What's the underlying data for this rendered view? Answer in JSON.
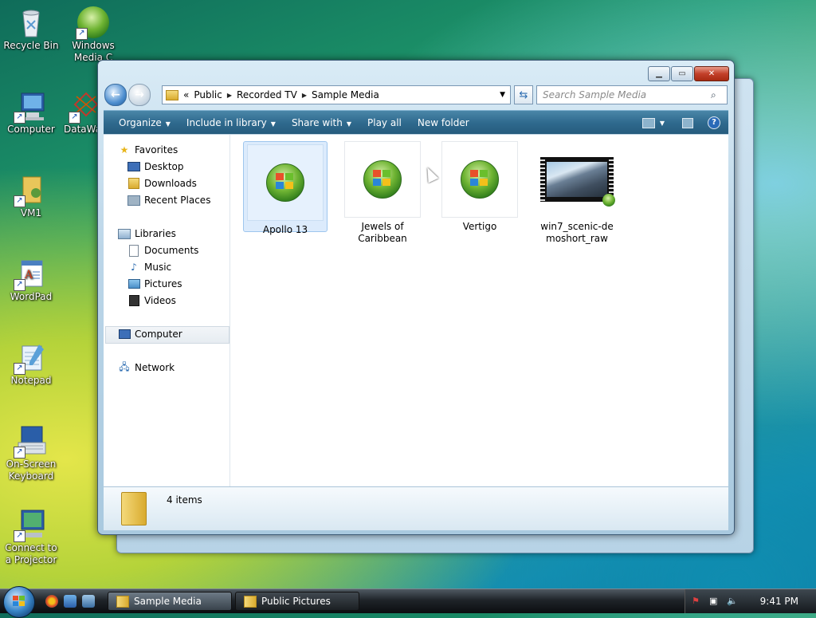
{
  "desktop": {
    "icons": [
      {
        "label": "Recycle Bin",
        "icon": "recycle-bin-icon"
      },
      {
        "label": "Windows Media C",
        "icon": "windows-media-center-icon"
      },
      {
        "label": "Computer",
        "icon": "computer-icon"
      },
      {
        "label": "DataWa",
        "icon": "datawarehouse-icon"
      },
      {
        "label": "VM1",
        "icon": "user-folder-icon"
      },
      {
        "label": "WordPad",
        "icon": "wordpad-icon"
      },
      {
        "label": "Notepad",
        "icon": "notepad-icon"
      },
      {
        "label": "On-Screen Keyboard",
        "icon": "keyboard-icon"
      },
      {
        "label": "Connect to a Projector",
        "icon": "projector-icon"
      }
    ]
  },
  "window": {
    "title": "Sample Media",
    "address": {
      "overflow": "«",
      "crumbs": [
        "Public",
        "Recorded TV",
        "Sample Media"
      ]
    },
    "search": {
      "placeholder": "Search Sample Media"
    },
    "toolbar": {
      "organize": "Organize",
      "include_in_library": "Include in library",
      "share_with": "Share with",
      "play_all": "Play all",
      "new_folder": "New folder"
    },
    "nav": {
      "favorites": "Favorites",
      "desktop": "Desktop",
      "downloads": "Downloads",
      "recent_places": "Recent Places",
      "libraries": "Libraries",
      "documents": "Documents",
      "music": "Music",
      "pictures": "Pictures",
      "videos": "Videos",
      "computer": "Computer",
      "network": "Network"
    },
    "files": [
      {
        "name": "Apollo 13",
        "selected": true
      },
      {
        "name": "Jewels of Caribbean",
        "selected": false
      },
      {
        "name": "Vertigo",
        "selected": false
      },
      {
        "name": "win7_scenic-demoshort_raw",
        "selected": false
      }
    ],
    "status": {
      "count": "4 items"
    }
  },
  "taskbar": {
    "buttons": [
      {
        "label": "Sample Media",
        "active": true
      },
      {
        "label": "Public Pictures",
        "active": false
      }
    ],
    "clock": "9:41 PM"
  },
  "colors": {
    "toolbar": "#2f6a8e",
    "selection": "#dcebfc",
    "close_button": "#c3402a"
  }
}
